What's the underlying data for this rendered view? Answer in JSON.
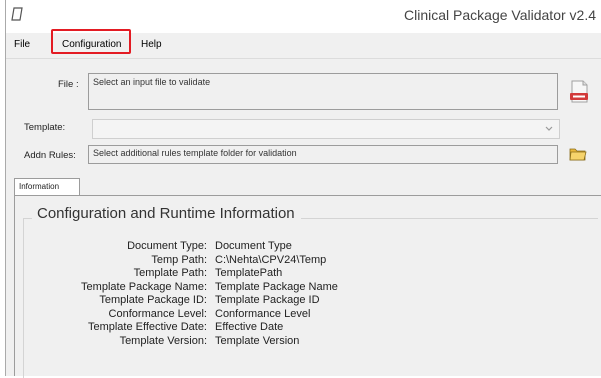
{
  "app": {
    "title": "Clinical Package Validator v2.4"
  },
  "menu": {
    "items": [
      "File",
      "Configuration",
      "Help"
    ]
  },
  "form": {
    "file_label": "File :",
    "file_placeholder": "Select an input file to validate",
    "template_label": "Template:",
    "template_value": "",
    "addn_rules_label": "Addn Rules:",
    "addn_rules_placeholder": "Select additional rules template folder for validation"
  },
  "tabs": [
    {
      "label": "Information"
    }
  ],
  "info": {
    "title": "Configuration and Runtime Information",
    "rows": [
      {
        "key": "Document Type:",
        "value": "Document Type"
      },
      {
        "key": "Temp Path:",
        "value": "C:\\Nehta\\CPV24\\Temp"
      },
      {
        "key": "Template Path:",
        "value": "TemplatePath"
      },
      {
        "key": "Template Package Name:",
        "value": "Template Package Name"
      },
      {
        "key": "Template Package ID:",
        "value": "Template Package ID"
      },
      {
        "key": "Conformance Level:",
        "value": "Conformance Level"
      },
      {
        "key": "Template Effective Date:",
        "value": "Effective Date"
      },
      {
        "key": "Template Version:",
        "value": "Template Version"
      }
    ]
  },
  "icons": {
    "app": "page-icon",
    "file_browse": "xml-file-icon",
    "rules_browse": "folder-icon",
    "dropdown": "chevron-down-icon"
  },
  "colors": {
    "highlight_border": "#e31b23",
    "xml_badge": "#d23a3a",
    "folder": "#e9b73b"
  }
}
